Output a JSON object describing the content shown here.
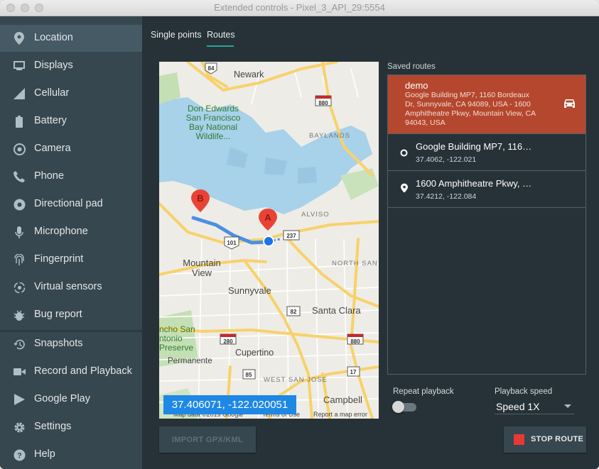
{
  "window": {
    "title": "Extended controls - Pixel_3_API_29:5554"
  },
  "sidebar": {
    "items": [
      {
        "label": "Location",
        "icon": "location-pin-icon"
      },
      {
        "label": "Displays",
        "icon": "display-icon"
      },
      {
        "label": "Cellular",
        "icon": "signal-icon"
      },
      {
        "label": "Battery",
        "icon": "battery-icon"
      },
      {
        "label": "Camera",
        "icon": "camera-icon"
      },
      {
        "label": "Phone",
        "icon": "phone-icon"
      },
      {
        "label": "Directional pad",
        "icon": "dpad-icon"
      },
      {
        "label": "Microphone",
        "icon": "microphone-icon"
      },
      {
        "label": "Fingerprint",
        "icon": "fingerprint-icon"
      },
      {
        "label": "Virtual sensors",
        "icon": "sensors-icon"
      },
      {
        "label": "Bug report",
        "icon": "bug-icon"
      },
      {
        "label": "Snapshots",
        "icon": "history-icon"
      },
      {
        "label": "Record and Playback",
        "icon": "video-camera-icon"
      },
      {
        "label": "Google Play",
        "icon": "play-store-icon"
      },
      {
        "label": "Settings",
        "icon": "gear-icon"
      },
      {
        "label": "Help",
        "icon": "help-icon"
      }
    ],
    "active": "Location"
  },
  "tabs": [
    {
      "label": "Single points",
      "active": false
    },
    {
      "label": "Routes",
      "active": true
    }
  ],
  "map": {
    "coords_readout": "37.406071, -122.020051",
    "footer": {
      "map_data": "Map data ©2019 Google",
      "terms": "Terms of Use",
      "report": "Report a map error"
    },
    "places": {
      "newark": "Newark",
      "don_edwards": [
        "Don Edwards",
        "San Francisco",
        "Bay National",
        "Wildlife..."
      ],
      "baylands": "BAYLANDS",
      "alviso": "ALVISO",
      "north_san": "NORTH SAN",
      "mountain_view": [
        "Mountain",
        "View"
      ],
      "sunnyvale": "Sunnyvale",
      "santa_clara": "Santa Clara",
      "rancho": [
        "ncho San",
        "ntonio",
        "Preserve"
      ],
      "cupertino": "Cupertino",
      "permanente": "Permanente",
      "west_san_jose": "WEST SAN JOSE",
      "campbell": "Campbell"
    },
    "shields": {
      "s84": "84",
      "s880a": "880",
      "s237": "237",
      "s101": "101",
      "s82": "82",
      "s280": "280",
      "s880b": "880",
      "s85": "85",
      "s17": "17"
    },
    "markers": {
      "a": "A",
      "b": "B"
    }
  },
  "buttons": {
    "import": "IMPORT GPX/KML",
    "stop": "STOP ROUTE"
  },
  "saved_routes": {
    "label": "Saved routes",
    "items": [
      {
        "name": "demo",
        "description": [
          "Google Building MP7, 1160 Bordeaux",
          "Dr, Sunnyvale, CA 94089, USA - 1600",
          "Amphitheatre Pkwy, Mountain View, CA",
          "94043, USA"
        ],
        "selected": true,
        "icon": "car-icon"
      },
      {
        "name": "Google Building MP7, 116…",
        "coords": "37.4062, -122.021",
        "icon": "start-circle-icon"
      },
      {
        "name": "1600 Amphitheatre Pkwy, …",
        "coords": "37.4212, -122.084",
        "icon": "location-pin-icon"
      }
    ]
  },
  "playback": {
    "repeat_label": "Repeat playback",
    "repeat_on": false,
    "speed_label": "Playback speed",
    "speed_value": "Speed 1X"
  },
  "colors": {
    "accent": "#26a69a",
    "selected_route": "#b5472f",
    "route_line": "#4a90e2",
    "stop": "#e53935"
  }
}
